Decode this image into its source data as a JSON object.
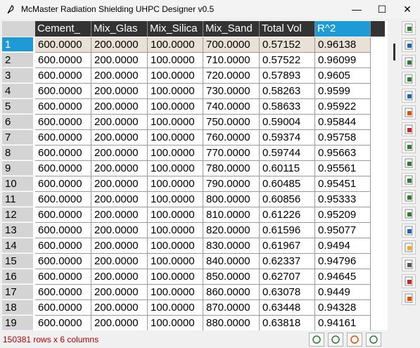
{
  "window": {
    "title": "McMaster Radiation Shielding UHPC Designer v0.5",
    "minimize": "—",
    "maximize": "☐",
    "close": "✕"
  },
  "table": {
    "columns": [
      "Cement_",
      "Mix_Glas",
      "Mix_Silica",
      "Mix_Sand",
      "Total Vol",
      "R^2"
    ],
    "selected_column": 5,
    "selected_row": 0,
    "rows": [
      {
        "idx": "1",
        "cells": [
          "600.0000",
          "200.0000",
          "100.0000",
          "700.0000",
          "0.57152",
          "0.96138"
        ]
      },
      {
        "idx": "2",
        "cells": [
          "600.0000",
          "200.0000",
          "100.0000",
          "710.0000",
          "0.57522",
          "0.96099"
        ]
      },
      {
        "idx": "3",
        "cells": [
          "600.0000",
          "200.0000",
          "100.0000",
          "720.0000",
          "0.57893",
          "0.9605"
        ]
      },
      {
        "idx": "4",
        "cells": [
          "600.0000",
          "200.0000",
          "100.0000",
          "730.0000",
          "0.58263",
          "0.9599"
        ]
      },
      {
        "idx": "5",
        "cells": [
          "600.0000",
          "200.0000",
          "100.0000",
          "740.0000",
          "0.58633",
          "0.95922"
        ]
      },
      {
        "idx": "6",
        "cells": [
          "600.0000",
          "200.0000",
          "100.0000",
          "750.0000",
          "0.59004",
          "0.95844"
        ]
      },
      {
        "idx": "7",
        "cells": [
          "600.0000",
          "200.0000",
          "100.0000",
          "760.0000",
          "0.59374",
          "0.95758"
        ]
      },
      {
        "idx": "8",
        "cells": [
          "600.0000",
          "200.0000",
          "100.0000",
          "770.0000",
          "0.59744",
          "0.95663"
        ]
      },
      {
        "idx": "9",
        "cells": [
          "600.0000",
          "200.0000",
          "100.0000",
          "780.0000",
          "0.60115",
          "0.95561"
        ]
      },
      {
        "idx": "10",
        "cells": [
          "600.0000",
          "200.0000",
          "100.0000",
          "790.0000",
          "0.60485",
          "0.95451"
        ]
      },
      {
        "idx": "11",
        "cells": [
          "600.0000",
          "200.0000",
          "100.0000",
          "800.0000",
          "0.60856",
          "0.95333"
        ]
      },
      {
        "idx": "12",
        "cells": [
          "600.0000",
          "200.0000",
          "100.0000",
          "810.0000",
          "0.61226",
          "0.95209"
        ]
      },
      {
        "idx": "13",
        "cells": [
          "600.0000",
          "200.0000",
          "100.0000",
          "820.0000",
          "0.61596",
          "0.95077"
        ]
      },
      {
        "idx": "14",
        "cells": [
          "600.0000",
          "200.0000",
          "100.0000",
          "830.0000",
          "0.61967",
          "0.9494"
        ]
      },
      {
        "idx": "15",
        "cells": [
          "600.0000",
          "200.0000",
          "100.0000",
          "840.0000",
          "0.62337",
          "0.94796"
        ]
      },
      {
        "idx": "16",
        "cells": [
          "600.0000",
          "200.0000",
          "100.0000",
          "850.0000",
          "0.62707",
          "0.94645"
        ]
      },
      {
        "idx": "17",
        "cells": [
          "600.0000",
          "200.0000",
          "100.0000",
          "860.0000",
          "0.63078",
          "0.9449"
        ]
      },
      {
        "idx": "18",
        "cells": [
          "600.0000",
          "200.0000",
          "100.0000",
          "870.0000",
          "0.63448",
          "0.94328"
        ]
      },
      {
        "idx": "19",
        "cells": [
          "600.0000",
          "200.0000",
          "100.0000",
          "880.0000",
          "0.63818",
          "0.94161"
        ]
      }
    ]
  },
  "toolbar": {
    "icons": [
      "save-icon",
      "new-table-icon",
      "open-file-icon",
      "excel-export-icon",
      "copy-icon",
      "paste-icon",
      "plot-icon",
      "undo-icon",
      "redo-icon",
      "transpose-icon",
      "merge-icon",
      "column-chart-icon",
      "duplicate-icon",
      "edit-icon",
      "calculator-icon",
      "analysis-chart-icon",
      "report-icon"
    ]
  },
  "status": {
    "text": "150381 rows x 6 columns"
  },
  "nav": {
    "icons": [
      "prev-page-icon",
      "next-page-icon",
      "zoom-out-icon",
      "zoom-in-icon"
    ]
  },
  "colors": {
    "header_bg": "#333333",
    "selected": "#1e9bd7",
    "selected_row": "#e9e0d6",
    "status_text": "#b00000"
  }
}
